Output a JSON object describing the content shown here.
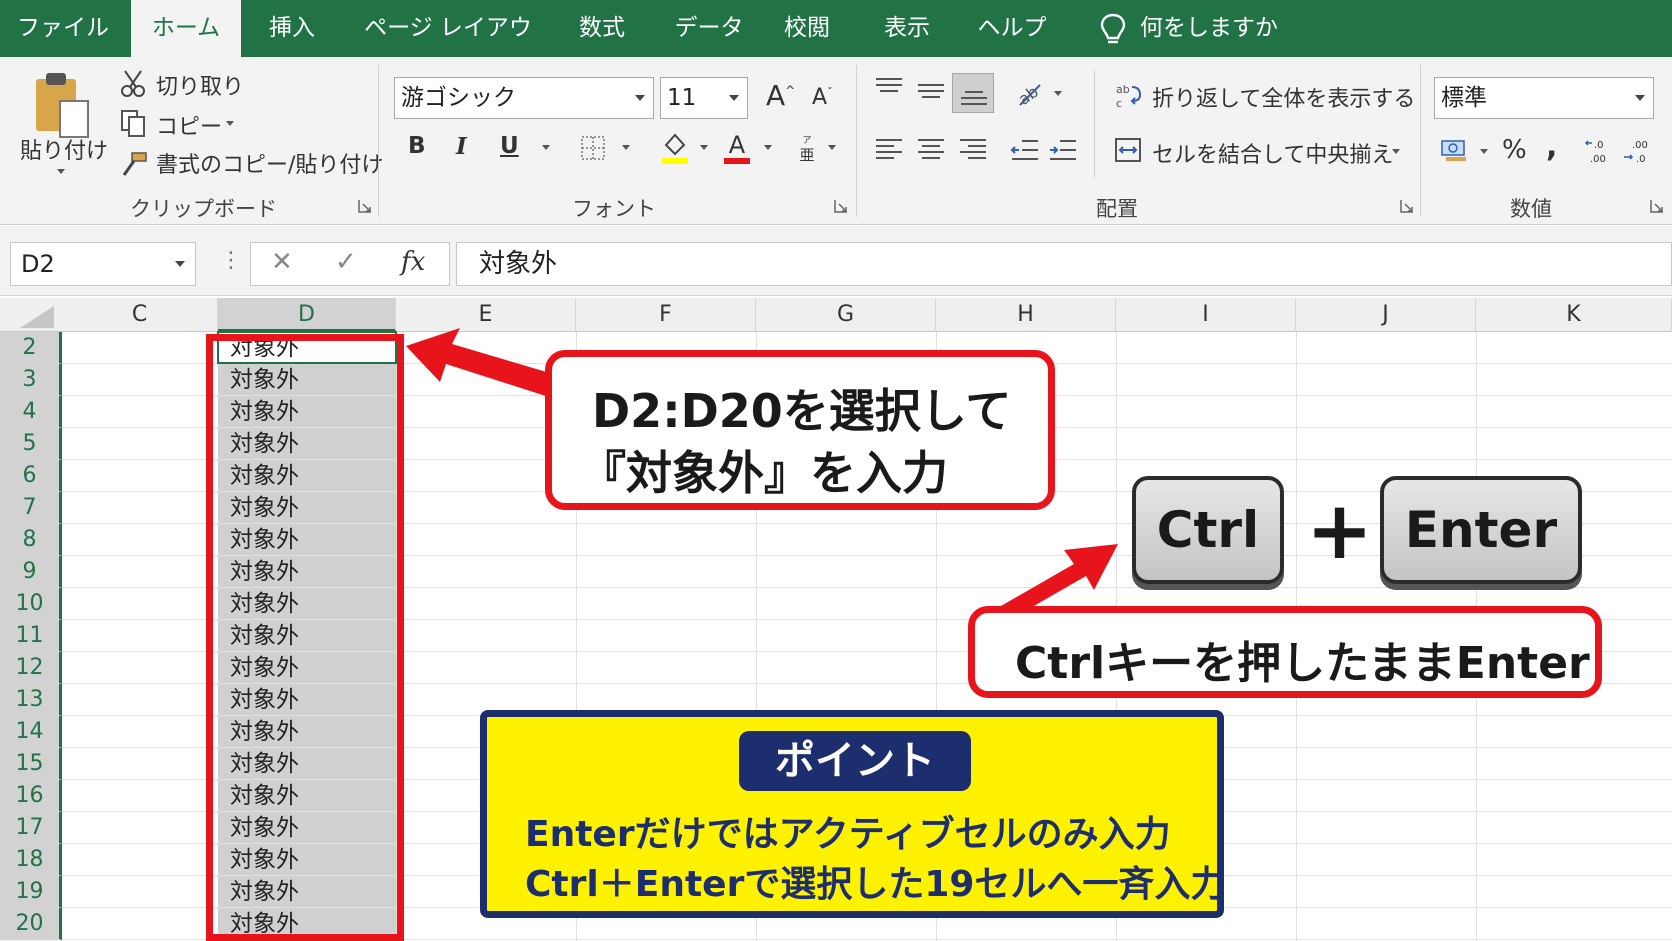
{
  "tabs": [
    {
      "label": "ファイル",
      "active": false
    },
    {
      "label": "ホーム",
      "active": true
    },
    {
      "label": "挿入",
      "active": false
    },
    {
      "label": "ページ レイアウト",
      "active": false
    },
    {
      "label": "数式",
      "active": false
    },
    {
      "label": "データ",
      "active": false
    },
    {
      "label": "校閲",
      "active": false
    },
    {
      "label": "表示",
      "active": false
    },
    {
      "label": "ヘルプ",
      "active": false
    }
  ],
  "tell_me": "何をしますか",
  "clipboard": {
    "paste_label": "貼り付け",
    "cut_label": "切り取り",
    "copy_label": "コピー",
    "format_painter_label": "書式のコピー/貼り付け",
    "group_label": "クリップボード"
  },
  "font": {
    "family": "游ゴシック",
    "size": "11",
    "bold": "B",
    "italic": "I",
    "underline": "U",
    "group_label": "フォント"
  },
  "alignment": {
    "wrap_text_label": "折り返して全体を表示する",
    "merge_center_label": "セルを結合して中央揃え",
    "group_label": "配置"
  },
  "number": {
    "format": "標準",
    "percent": "%",
    "comma": ",",
    "group_label": "数値"
  },
  "formula_bar": {
    "name_box": "D2",
    "cancel": "✕",
    "enter": "✓",
    "fx": "fx",
    "content": "対象外"
  },
  "sheet": {
    "columns": [
      "C",
      "D",
      "E",
      "F",
      "G",
      "H",
      "I",
      "J",
      "K"
    ],
    "selected_column": "D",
    "rows": [
      "2",
      "3",
      "4",
      "5",
      "6",
      "7",
      "8",
      "9",
      "10",
      "11",
      "12",
      "13",
      "14",
      "15",
      "16",
      "17",
      "18",
      "19",
      "20"
    ],
    "cell_values": [
      "対象外",
      "対象外",
      "対象外",
      "対象外",
      "対象外",
      "対象外",
      "対象外",
      "対象外",
      "対象外",
      "対象外",
      "対象外",
      "対象外",
      "対象外",
      "対象外",
      "対象外",
      "対象外",
      "対象外",
      "対象外",
      "対象外"
    ]
  },
  "annotations": {
    "callout_select_line1": "D2:D20を選択して",
    "callout_select_line2": "『対象外』を入力",
    "key_ctrl": "Ctrl",
    "key_plus": "+",
    "key_enter": "Enter",
    "callout_keys": "Ctrlキーを押したままEnter",
    "point_title": "ポイント",
    "point_line1": "Enterだけではアクティブセルのみ入力",
    "point_line2": "Ctrl＋Enterで選択した19セルへ一斉入力"
  },
  "colors": {
    "excel_green": "#217346",
    "callout_red": "#e8141c",
    "point_yellow": "#fff200",
    "point_navy": "#1c2e6e"
  }
}
